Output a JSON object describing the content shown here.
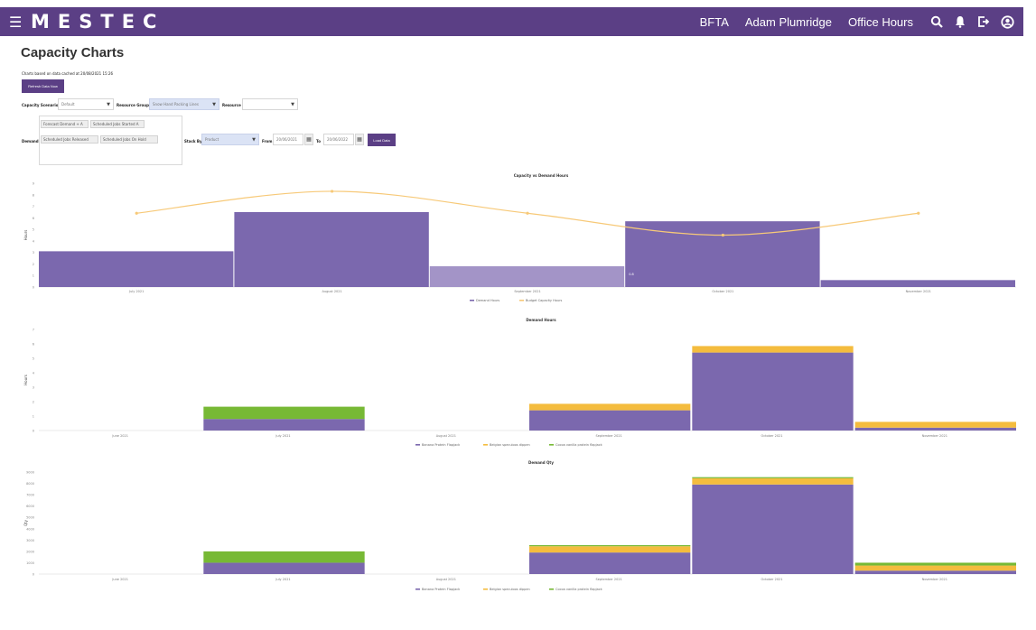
{
  "app": {
    "logo": "MESTEC",
    "site": "BFTA",
    "user": "Adam Plumridge",
    "hours_mode": "Office Hours"
  },
  "page": {
    "title": "Capacity Charts",
    "cache_note": "Charts based on data cached at 20/08/2021 15:26",
    "refresh_label": "Refresh Data Now"
  },
  "filters": {
    "capacity_scenario_label": "Capacity Scenario",
    "capacity_scenario_value": "Default",
    "resource_group_label": "Resource Group",
    "resource_group_value": "Snow Hand Packing Lines",
    "resource_label": "Resource",
    "resource_value": "",
    "demand_label": "Demand",
    "demand_chips": [
      "Forecast Demand + A",
      "Scheduled Jobs Started A",
      "Scheduled Jobs Released",
      "Scheduled Jobs On Hold"
    ],
    "stack_by_label": "Stack By",
    "stack_by_value": "Product",
    "from_label": "From",
    "from_value": "20/06/2021",
    "to_label": "To",
    "to_value": "20/06/2022",
    "load_label": "Load Data"
  },
  "colors": {
    "brand": "#5b3f85",
    "demand": "#7b68ae",
    "demand_light": "#a394c7",
    "budget": "#f7c978",
    "banana": "#7b68ae",
    "belgian": "#f4bc3e",
    "cocoa": "#77b935"
  },
  "chart_data": [
    {
      "type": "bar",
      "title": "Capacity vs Demand Hours",
      "ylabel": "Hours",
      "categories": [
        "July 2021",
        "August 2021",
        "September 2021",
        "October 2021",
        "November 2021"
      ],
      "ylim": [
        0,
        9
      ],
      "yticks": [
        "0",
        "1",
        "2",
        "3",
        "4",
        "5",
        "6",
        "7",
        "8",
        "9"
      ],
      "series": [
        {
          "name": "Demand Hours",
          "type": "bar",
          "color": "#7b68ae",
          "values": [
            3.1,
            6.5,
            1.8,
            5.7,
            0.6
          ]
        },
        {
          "name": "Budget Capacity Hours",
          "type": "line",
          "color": "#f7c978",
          "values": [
            6.4,
            8.3,
            6.4,
            4.5,
            6.4
          ]
        }
      ],
      "data_labels": [
        {
          "category": "September 2021",
          "text": "0.8"
        }
      ],
      "legend": "bottom"
    },
    {
      "type": "bar",
      "stacked": true,
      "title": "Demand Hours",
      "ylabel": "Hours",
      "categories": [
        "June 2021",
        "July 2021",
        "August 2021",
        "September 2021",
        "October 2021",
        "November 2021"
      ],
      "ylim": [
        0,
        7
      ],
      "yticks": [
        "0",
        "1",
        "2",
        "3",
        "4",
        "5",
        "6",
        "7"
      ],
      "series": [
        {
          "name": "Banana Protein Flapjack",
          "color": "#7b68ae",
          "values": [
            0,
            0.8,
            0,
            1.4,
            5.4,
            0.2
          ]
        },
        {
          "name": "Belgian speculoos dippen",
          "color": "#f4bc3e",
          "values": [
            0,
            0,
            0,
            0.45,
            0.45,
            0.4
          ]
        },
        {
          "name": "Cocoa vanilla protein flapjack",
          "color": "#77b935",
          "values": [
            0,
            0.85,
            0,
            0,
            0,
            0
          ]
        }
      ],
      "legend": "bottom"
    },
    {
      "type": "bar",
      "stacked": true,
      "title": "Demand Qty",
      "ylabel": "Qty",
      "categories": [
        "June 2021",
        "July 2021",
        "August 2021",
        "September 2021",
        "October 2021",
        "November 2021"
      ],
      "ylim": [
        0,
        9000
      ],
      "yticks": [
        "0",
        "1000",
        "2000",
        "3000",
        "4000",
        "5000",
        "6000",
        "7000",
        "8000",
        "9000"
      ],
      "series": [
        {
          "name": "Banana Protein Flapjack",
          "color": "#7b68ae",
          "values": [
            0,
            1000,
            0,
            1900,
            7900,
            300
          ]
        },
        {
          "name": "Belgian speculoos dippen",
          "color": "#f4bc3e",
          "values": [
            0,
            0,
            0,
            550,
            550,
            450
          ]
        },
        {
          "name": "Cocoa vanilla protein flapjack",
          "color": "#77b935",
          "values": [
            0,
            1000,
            0,
            100,
            100,
            250
          ]
        }
      ],
      "legend": "bottom"
    }
  ]
}
